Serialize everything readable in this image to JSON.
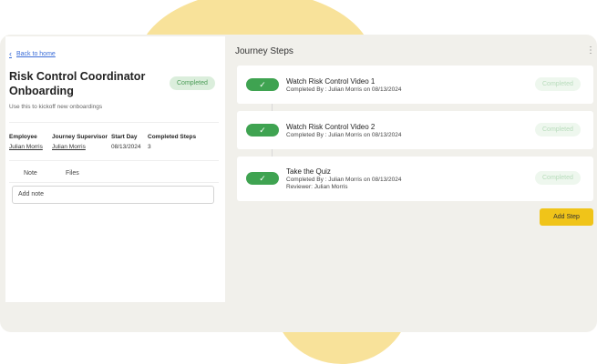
{
  "left": {
    "back_label": "Back to home",
    "title": "Risk Control Coordinator Onboarding",
    "status": "Completed",
    "subtitle": "Use this to kickoff new onboardings",
    "meta": {
      "employee_label": "Employee",
      "employee_value": "Julian Morris",
      "supervisor_label": "Journey Supervisor",
      "supervisor_value": "Julian Morris",
      "start_label": "Start Day",
      "start_value": "08/13/2024",
      "steps_label": "Completed Steps",
      "steps_value": "3"
    },
    "tabs": [
      {
        "label": "Note"
      },
      {
        "label": "Files"
      }
    ],
    "note_placeholder": "Add note"
  },
  "right": {
    "title": "Journey Steps",
    "menu_icon": "kebab-icon",
    "steps": [
      {
        "title": "Watch Risk Control Video 1",
        "completed_by": "Completed By : Julian Morris on 08/13/2024",
        "status": "Completed",
        "icon": "check-icon"
      },
      {
        "title": "Watch Risk Control Video 2",
        "completed_by": "Completed By : Julian Morris on 08/13/2024",
        "status": "Completed",
        "icon": "check-icon"
      },
      {
        "title": "Take the Quiz",
        "completed_by": "Completed By : Julian Morris on 08/13/2024",
        "reviewer": "Reviewer: Julian Morris",
        "status": "Completed",
        "icon": "check-icon"
      }
    ],
    "add_step_label": "Add Step"
  },
  "colors": {
    "accent": "#f0c419",
    "success": "#3fa351",
    "link": "#3b6dd8",
    "decor": "#f8e29a"
  }
}
